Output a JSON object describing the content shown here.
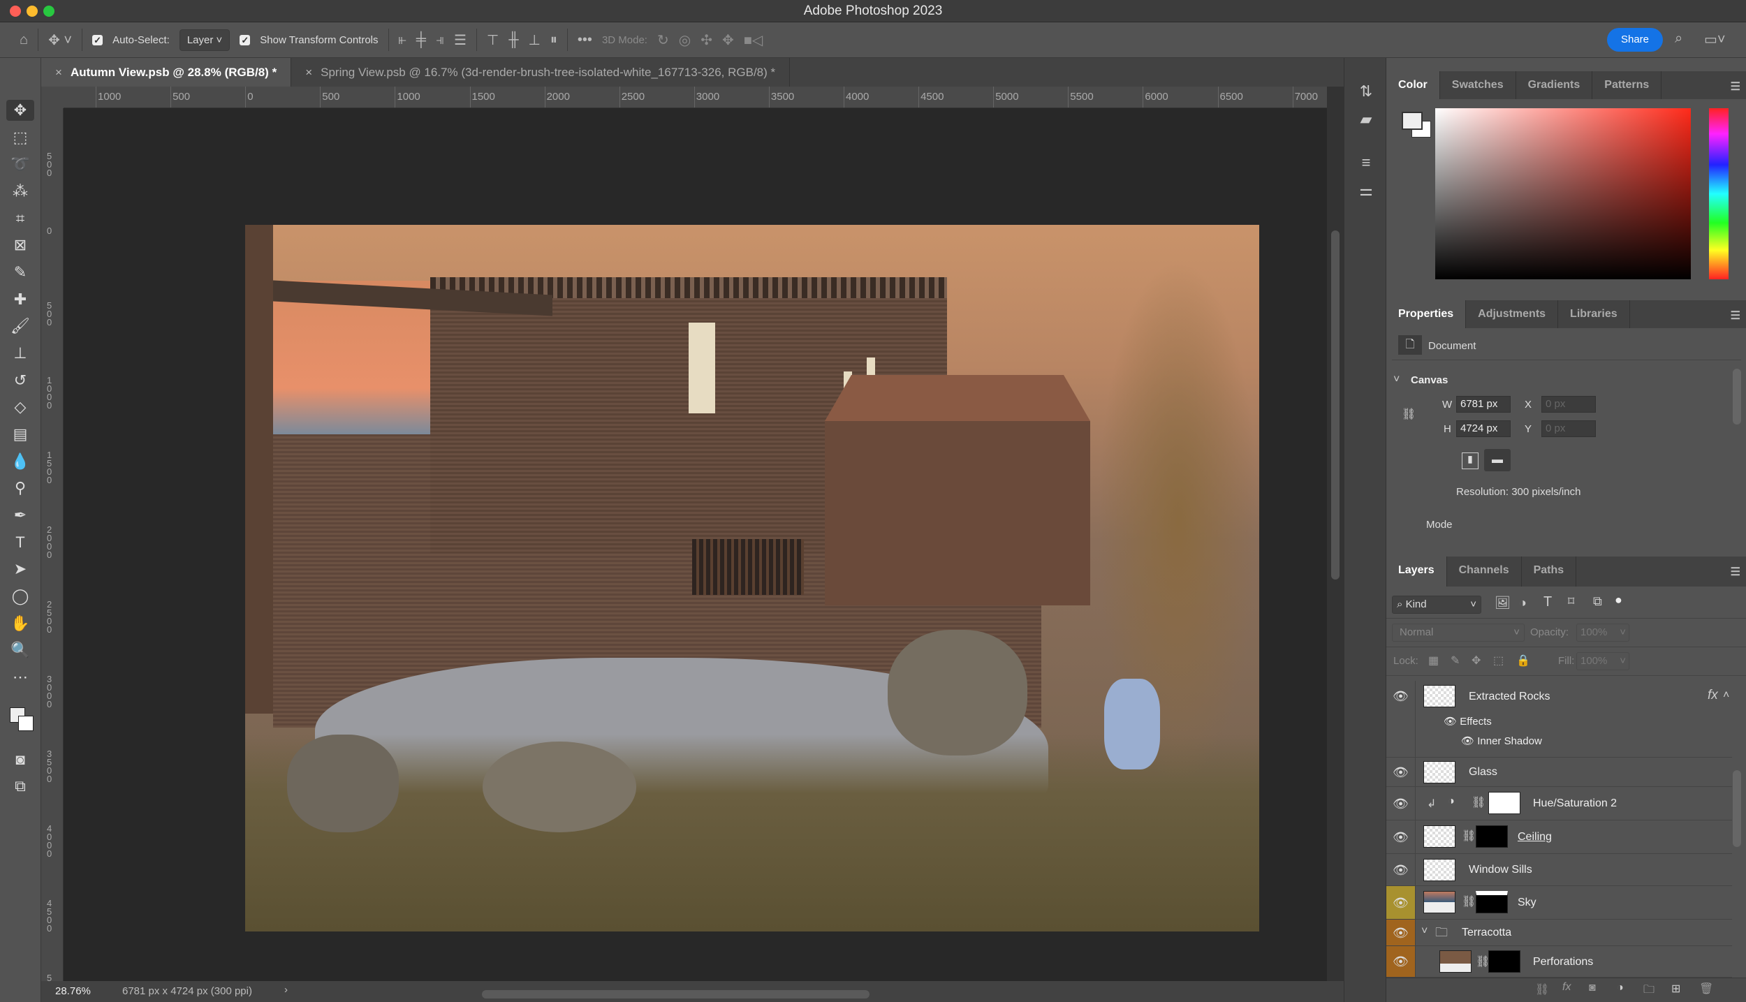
{
  "app": {
    "title": "Adobe Photoshop 2023",
    "share_label": "Share"
  },
  "options": {
    "auto_select_label": "Auto-Select:",
    "auto_select_value": "Layer",
    "show_transform_label": "Show Transform Controls",
    "three_d_label": "3D Mode:"
  },
  "tabs": [
    {
      "label": "Autumn View.psb @ 28.8% (RGB/8) *",
      "active": true
    },
    {
      "label": "Spring View.psb @ 16.7% (3d-render-brush-tree-isolated-white_167713-326, RGB/8) *",
      "active": false
    }
  ],
  "ruler": {
    "h_labels": [
      "1000",
      "500",
      "0",
      "500",
      "1000",
      "1500",
      "2000",
      "2500",
      "3000",
      "3500",
      "4000",
      "4500",
      "5000",
      "5500",
      "6000",
      "6500",
      "7000"
    ],
    "v_labels": [
      "500",
      "0",
      "500",
      "1000",
      "1500",
      "2000",
      "2500",
      "3000",
      "3500",
      "4000",
      "4500",
      "5"
    ]
  },
  "status": {
    "zoom": "28.76%",
    "doc_info": "6781 px x 4724 px (300 ppi)",
    "arrow": "›"
  },
  "color_panel": {
    "tabs": [
      "Color",
      "Swatches",
      "Gradients",
      "Patterns"
    ],
    "hue": "#ff2a1a",
    "foreground": "#eeeeee",
    "background": "#ffffff"
  },
  "properties_panel": {
    "tabs": [
      "Properties",
      "Adjustments",
      "Libraries"
    ],
    "doc_label": "Document",
    "section": "Canvas",
    "w_label": "W",
    "w_value": "6781 px",
    "h_label": "H",
    "h_value": "4724 px",
    "x_label": "X",
    "x_value": "0 px",
    "y_label": "Y",
    "y_value": "0 px",
    "resolution": "Resolution: 300 pixels/inch",
    "mode_label": "Mode"
  },
  "layers_panel": {
    "tabs": [
      "Layers",
      "Channels",
      "Paths"
    ],
    "filter": "Kind",
    "blend_mode": "Normal",
    "opacity_label": "Opacity:",
    "opacity_value": "100%",
    "lock_label": "Lock:",
    "fill_label": "Fill:",
    "fill_value": "100%",
    "layers": [
      {
        "name": "Extracted Rocks",
        "fx": "fx",
        "effects_label": "Effects",
        "effect": "Inner Shadow"
      },
      {
        "name": "Glass"
      },
      {
        "name": "Hue/Saturation 2"
      },
      {
        "name": "Ceiling"
      },
      {
        "name": "Window Sills"
      },
      {
        "name": "Sky",
        "color_tag": "#a8912f"
      },
      {
        "name": "Terracotta",
        "color_tag": "#a0641e"
      },
      {
        "name": "Perforations",
        "color_tag": "#a0641e"
      }
    ]
  }
}
